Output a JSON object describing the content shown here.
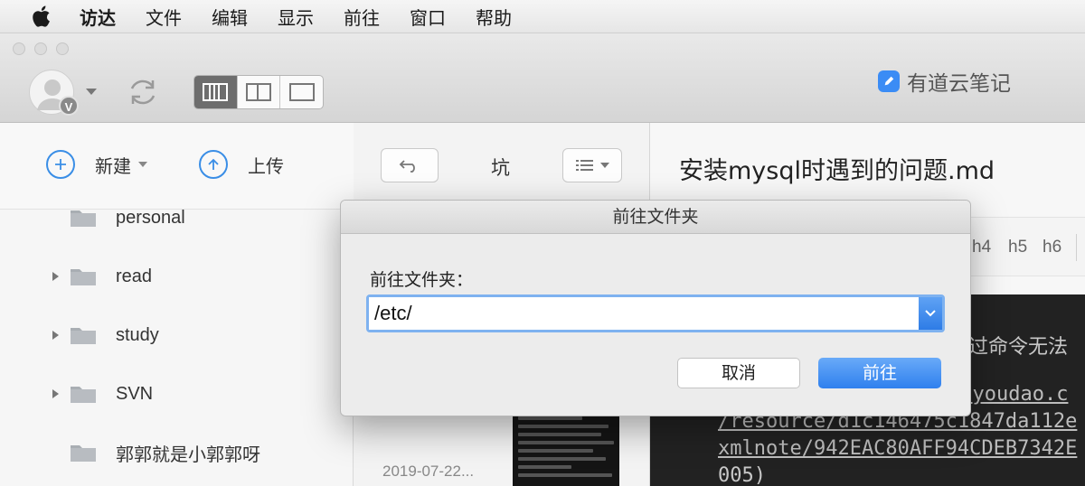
{
  "menubar": {
    "items": [
      {
        "label": "访达",
        "bold": true
      },
      {
        "label": "文件"
      },
      {
        "label": "编辑"
      },
      {
        "label": "显示"
      },
      {
        "label": "前往"
      },
      {
        "label": "窗口"
      },
      {
        "label": "帮助"
      }
    ]
  },
  "toolbar": {
    "avatar_badge": "V",
    "brand_name": "有道云笔记",
    "accent_color": "#3a8ee6"
  },
  "sidebar": {
    "new_label": "新建",
    "upload_label": "上传",
    "folders": [
      {
        "label": "personal",
        "expandable": false
      },
      {
        "label": "read",
        "expandable": true
      },
      {
        "label": "study",
        "expandable": true
      },
      {
        "label": "SVN",
        "expandable": true
      },
      {
        "label": "郭郭就是小郭郭呀",
        "expandable": false
      }
    ]
  },
  "midpane": {
    "title": "坑",
    "note_date": "2019-07-22..."
  },
  "editor": {
    "doc_title": "安装mysql时遇到的问题.md",
    "headings": [
      "h4",
      "h5",
      "h6"
    ],
    "code_lines": [
      "通过命令无法",
      "e.youdao.c",
      "/resource/d1c146475c1847da112e",
      "xmlnote/942EAC80AFF94CDEB7342E",
      "005)"
    ]
  },
  "dialog": {
    "title": "前往文件夹",
    "prompt": "前往文件夹：",
    "path_value": "/etc/",
    "cancel_label": "取消",
    "go_label": "前往"
  }
}
